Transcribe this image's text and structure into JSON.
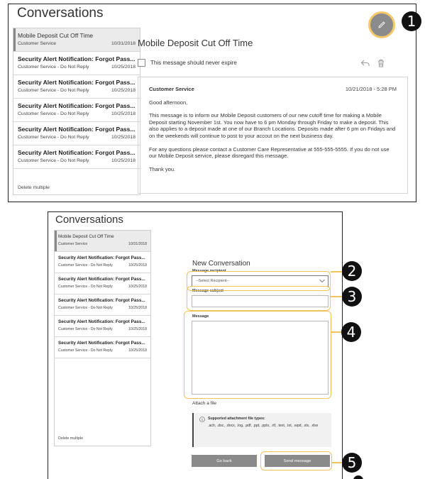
{
  "top": {
    "title": "Conversations",
    "list": [
      {
        "subject": "Mobile Deposit Cut Off Time",
        "sender": "Customer Service",
        "date": "10/31/2018",
        "selected": true,
        "unread": false
      },
      {
        "subject": "Security Alert Notification: Forgot Pass...",
        "sender": "Customer Service - Do Not Reply",
        "date": "10/25/2018",
        "selected": false,
        "unread": true
      },
      {
        "subject": "Security Alert Notification: Forgot Pass...",
        "sender": "Customer Service - Do Not Reply",
        "date": "10/25/2018",
        "selected": false,
        "unread": true
      },
      {
        "subject": "Security Alert Notification: Forgot Pass...",
        "sender": "Customer Service - Do Not Reply",
        "date": "10/25/2018",
        "selected": false,
        "unread": true
      },
      {
        "subject": "Security Alert Notification: Forgot Pass...",
        "sender": "Customer Service - Do Not Reply",
        "date": "10/25/2018",
        "selected": false,
        "unread": true
      },
      {
        "subject": "Security Alert Notification: Forgot Pass...",
        "sender": "Customer Service - Do Not Reply",
        "date": "10/25/2018",
        "selected": false,
        "unread": true
      }
    ],
    "delete_multiple": "Delete multiple",
    "message_title": "Mobile Deposit Cut Off Time",
    "never_expire_label": "This message should never expire",
    "message": {
      "sender": "Customer Service",
      "datetime": "10/21/2018 - 5:28 PM",
      "greeting": "Good afternoon,",
      "body1": "This message is to inform our Mobile Deposit customers of our new cutoff time for making a Mobile Deposit starting November 1st. You now have to 6 pm Monday through Friday to make a deposit. This also applies to a deposit made at one of our Branch Locations. Deposits made after 6 pm on Fridays and on the weekends will continue to post to your accout on the next business day.",
      "body2": "For any questions please contact a Customer Care Representative at 555-555-5555. If you do not use our Mobile Deposit service, please disregard this message.",
      "closing": "Thank you."
    }
  },
  "bottom": {
    "title": "Conversations",
    "list": [
      {
        "subject": "Mobile Deposit Cut Off Time",
        "sender": "Customer Service",
        "date": "10/31/2018",
        "selected": true,
        "unread": false
      },
      {
        "subject": "Security Alert Notification: Forgot Pass...",
        "sender": "Customer Service - Do Not Reply",
        "date": "10/25/2018",
        "selected": false,
        "unread": true
      },
      {
        "subject": "Security Alert Notification: Forgot Pass...",
        "sender": "Customer Service - Do Not Reply",
        "date": "10/25/2018",
        "selected": false,
        "unread": true
      },
      {
        "subject": "Security Alert Notification: Forgot Pass...",
        "sender": "Customer Service - Do Not Reply",
        "date": "10/25/2018",
        "selected": false,
        "unread": true
      },
      {
        "subject": "Security Alert Notification: Forgot Pass...",
        "sender": "Customer Service - Do Not Reply",
        "date": "10/25/2018",
        "selected": false,
        "unread": true
      },
      {
        "subject": "Security Alert Notification: Forgot Pass...",
        "sender": "Customer Service - Do Not Reply",
        "date": "10/25/2018",
        "selected": false,
        "unread": true
      }
    ],
    "delete_multiple": "Delete multiple",
    "new_conversation": "New Conversation",
    "recipient_label": "Message recipient",
    "recipient_value": "--Select Recipient--",
    "subject_label": "Message subject",
    "message_label": "Message",
    "attach_file": "Attach a file",
    "supported_title": "Supported attachment file types:",
    "supported_types": ".ach, .doc, .docx, .log, .pdf, .ppt, .pptx, .rtf, .text, .txt, .wpd, .xls, .xlsx",
    "go_back": "Go back",
    "send_message": "Send message"
  },
  "callouts": [
    "1",
    "2",
    "3",
    "4",
    "5"
  ],
  "colors": {
    "highlight": "#f2c25b",
    "callout": "#111111",
    "button": "#8a8a8a",
    "selected_row": "#ebebeb"
  }
}
